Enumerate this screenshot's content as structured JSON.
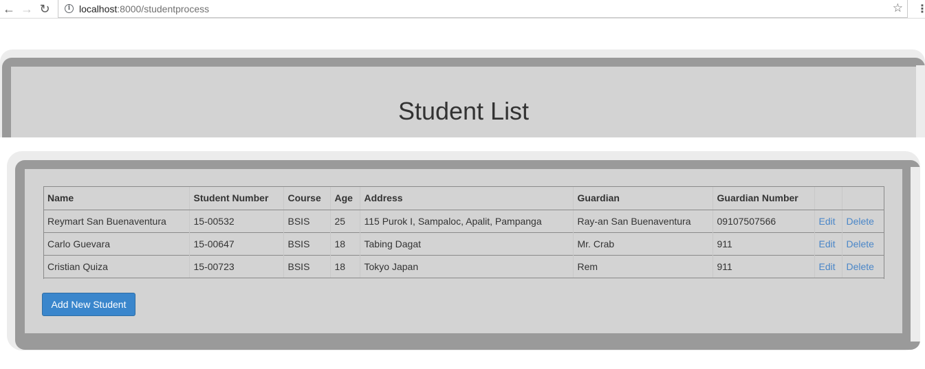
{
  "browser": {
    "back_icon": "back-arrow-icon",
    "forward_icon": "forward-arrow-icon",
    "reload_icon": "reload-icon",
    "url_host": "localhost",
    "url_rest": ":8000/studentprocess",
    "star_icon": "star-icon",
    "menu_icon": "kebab-menu-icon"
  },
  "header": {
    "title": "Student List"
  },
  "table": {
    "columns": [
      "Name",
      "Student Number",
      "Course",
      "Age",
      "Address",
      "Guardian",
      "Guardian Number",
      "",
      ""
    ],
    "rows": [
      {
        "name": "Reymart San Buenaventura",
        "student_number": "15-00532",
        "course": "BSIS",
        "age": "25",
        "address": "115 Purok I, Sampaloc, Apalit, Pampanga",
        "guardian": "Ray-an San Buenaventura",
        "guardian_number": "09107507566",
        "edit": "Edit",
        "delete": "Delete"
      },
      {
        "name": "Carlo Guevara",
        "student_number": "15-00647",
        "course": "BSIS",
        "age": "18",
        "address": "Tabing Dagat",
        "guardian": "Mr. Crab",
        "guardian_number": "911",
        "edit": "Edit",
        "delete": "Delete"
      },
      {
        "name": "Cristian Quiza",
        "student_number": "15-00723",
        "course": "BSIS",
        "age": "18",
        "address": "Tokyo Japan",
        "guardian": "Rem",
        "guardian_number": "911",
        "edit": "Edit",
        "delete": "Delete"
      }
    ]
  },
  "actions": {
    "add_label": "Add New Student"
  },
  "colors": {
    "panel_bg": "#d3d3d3",
    "frame": "#9a9a9a",
    "link": "#4a86c8",
    "button": "#3a86cc"
  }
}
